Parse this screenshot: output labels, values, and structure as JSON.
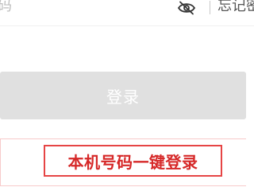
{
  "password_field": {
    "placeholder_fragment": "码",
    "visibility_toggle_icon": "eye-off-icon",
    "forgot_link_fragment": "忘记密"
  },
  "login_button": {
    "label": "登录",
    "background": "#e0e0e0",
    "text_color": "#ffffff"
  },
  "one_click_login": {
    "label": "本机号码一键登录",
    "accent_color": "#e64545"
  }
}
